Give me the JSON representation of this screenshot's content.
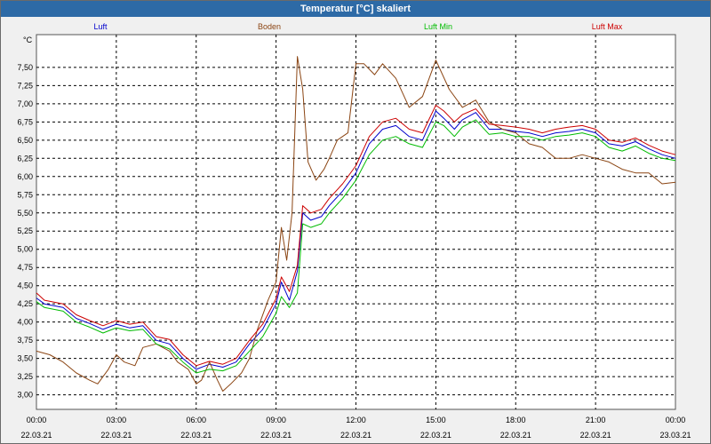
{
  "window": {
    "title": "Temperatur [°C] skaliert"
  },
  "chart_data": {
    "type": "line",
    "title": "Temperatur [°C] skaliert",
    "ylabel": "°C",
    "xlabel": "",
    "ylim": [
      2.8,
      7.95
    ],
    "xlim": [
      0,
      24
    ],
    "grid": true,
    "legend_position": "top",
    "y_ticks": [
      "3,00",
      "3,25",
      "3,50",
      "3,75",
      "4,00",
      "4,25",
      "4,50",
      "4,75",
      "5,00",
      "5,25",
      "5,50",
      "5,75",
      "6,00",
      "6,25",
      "6,50",
      "6,75",
      "7,00",
      "7,25",
      "7,50"
    ],
    "x_tick_times": [
      "00:00",
      "03:00",
      "06:00",
      "09:00",
      "12:00",
      "15:00",
      "18:00",
      "21:00",
      "00:00"
    ],
    "x_tick_dates": [
      "22.03.21",
      "22.03.21",
      "22.03.21",
      "22.03.21",
      "22.03.21",
      "22.03.21",
      "22.03.21",
      "22.03.21",
      "23.03.21"
    ],
    "series": [
      {
        "name": "Luft",
        "color": "#0000cc",
        "x": [
          0,
          0.3,
          1,
          1.5,
          2,
          2.5,
          3,
          3.5,
          4,
          4.5,
          5,
          5.5,
          6,
          6.5,
          7,
          7.5,
          8,
          8.5,
          9,
          9.2,
          9.5,
          9.8,
          10,
          10.3,
          10.7,
          11,
          11.5,
          12,
          12.5,
          13,
          13.5,
          14,
          14.5,
          15,
          15.3,
          15.7,
          16,
          16.5,
          17,
          17.5,
          18,
          18.5,
          19,
          19.5,
          20,
          20.5,
          21,
          21.5,
          22,
          22.5,
          23,
          23.5,
          24
        ],
        "values": [
          4.33,
          4.25,
          4.2,
          4.05,
          3.98,
          3.9,
          3.97,
          3.92,
          3.95,
          3.75,
          3.7,
          3.5,
          3.35,
          3.42,
          3.38,
          3.45,
          3.7,
          3.9,
          4.25,
          4.55,
          4.3,
          4.7,
          5.5,
          5.4,
          5.45,
          5.6,
          5.8,
          6.05,
          6.45,
          6.65,
          6.7,
          6.55,
          6.5,
          6.9,
          6.8,
          6.65,
          6.78,
          6.88,
          6.65,
          6.65,
          6.62,
          6.6,
          6.55,
          6.6,
          6.62,
          6.65,
          6.6,
          6.45,
          6.42,
          6.48,
          6.38,
          6.3,
          6.25
        ]
      },
      {
        "name": "Boden",
        "color": "#8b4513",
        "x": [
          0,
          0.5,
          1,
          1.5,
          2,
          2.3,
          2.7,
          3,
          3.3,
          3.7,
          4,
          4.5,
          5,
          5.3,
          5.7,
          6,
          6.2,
          6.5,
          6.8,
          7,
          7.3,
          7.7,
          8,
          8.3,
          8.7,
          9,
          9.2,
          9.4,
          9.6,
          9.8,
          10,
          10.2,
          10.5,
          10.8,
          11,
          11.3,
          11.7,
          12,
          12.3,
          12.7,
          13,
          13.5,
          14,
          14.5,
          15,
          15.5,
          16,
          16.5,
          17,
          17.5,
          18,
          18.5,
          19,
          19.5,
          20,
          20.5,
          21,
          21.5,
          22,
          22.5,
          23,
          23.5,
          24
        ],
        "values": [
          3.6,
          3.55,
          3.45,
          3.3,
          3.2,
          3.15,
          3.35,
          3.55,
          3.45,
          3.4,
          3.65,
          3.7,
          3.6,
          3.45,
          3.35,
          3.15,
          3.2,
          3.45,
          3.2,
          3.05,
          3.15,
          3.3,
          3.5,
          3.9,
          4.3,
          4.55,
          5.3,
          4.85,
          5.5,
          7.65,
          7.2,
          6.2,
          5.95,
          6.1,
          6.25,
          6.5,
          6.6,
          7.55,
          7.55,
          7.4,
          7.55,
          7.35,
          6.95,
          7.1,
          7.6,
          7.2,
          6.95,
          7.05,
          6.75,
          6.65,
          6.6,
          6.45,
          6.4,
          6.25,
          6.25,
          6.3,
          6.25,
          6.2,
          6.1,
          6.05,
          6.05,
          5.9,
          5.92
        ]
      },
      {
        "name": "Luft Min",
        "color": "#00bb00",
        "x": [
          0,
          0.3,
          1,
          1.5,
          2,
          2.5,
          3,
          3.5,
          4,
          4.5,
          5,
          5.5,
          6,
          6.5,
          7,
          7.5,
          8,
          8.5,
          9,
          9.2,
          9.5,
          9.8,
          10,
          10.3,
          10.7,
          11,
          11.5,
          12,
          12.5,
          13,
          13.5,
          14,
          14.5,
          15,
          15.3,
          15.7,
          16,
          16.5,
          17,
          17.5,
          18,
          18.5,
          19,
          19.5,
          20,
          20.5,
          21,
          21.5,
          22,
          22.5,
          23,
          23.5,
          24
        ],
        "values": [
          4.28,
          4.2,
          4.15,
          4.0,
          3.93,
          3.85,
          3.92,
          3.88,
          3.9,
          3.7,
          3.63,
          3.45,
          3.3,
          3.35,
          3.33,
          3.4,
          3.6,
          3.8,
          4.12,
          4.35,
          4.2,
          4.4,
          5.35,
          5.3,
          5.35,
          5.5,
          5.7,
          5.95,
          6.3,
          6.5,
          6.55,
          6.45,
          6.4,
          6.75,
          6.7,
          6.55,
          6.68,
          6.78,
          6.58,
          6.6,
          6.55,
          6.55,
          6.5,
          6.55,
          6.57,
          6.6,
          6.55,
          6.4,
          6.35,
          6.42,
          6.32,
          6.25,
          6.22
        ]
      },
      {
        "name": "Luft Max",
        "color": "#cc0000",
        "x": [
          0,
          0.3,
          1,
          1.5,
          2,
          2.5,
          3,
          3.5,
          4,
          4.5,
          5,
          5.5,
          6,
          6.5,
          7,
          7.5,
          8,
          8.5,
          9,
          9.2,
          9.5,
          9.8,
          10,
          10.3,
          10.7,
          11,
          11.5,
          12,
          12.5,
          13,
          13.5,
          14,
          14.5,
          15,
          15.3,
          15.7,
          16,
          16.5,
          17,
          17.5,
          18,
          18.5,
          19,
          19.5,
          20,
          20.5,
          21,
          21.5,
          22,
          22.5,
          23,
          23.5,
          24
        ],
        "values": [
          4.4,
          4.3,
          4.25,
          4.1,
          4.02,
          3.95,
          4.02,
          3.97,
          4.0,
          3.8,
          3.76,
          3.55,
          3.4,
          3.46,
          3.42,
          3.5,
          3.75,
          3.97,
          4.32,
          4.62,
          4.42,
          4.78,
          5.6,
          5.5,
          5.55,
          5.7,
          5.9,
          6.15,
          6.55,
          6.75,
          6.8,
          6.65,
          6.6,
          6.98,
          6.9,
          6.75,
          6.85,
          6.93,
          6.72,
          6.7,
          6.68,
          6.65,
          6.6,
          6.65,
          6.68,
          6.7,
          6.65,
          6.5,
          6.47,
          6.53,
          6.43,
          6.35,
          6.3
        ]
      }
    ]
  }
}
